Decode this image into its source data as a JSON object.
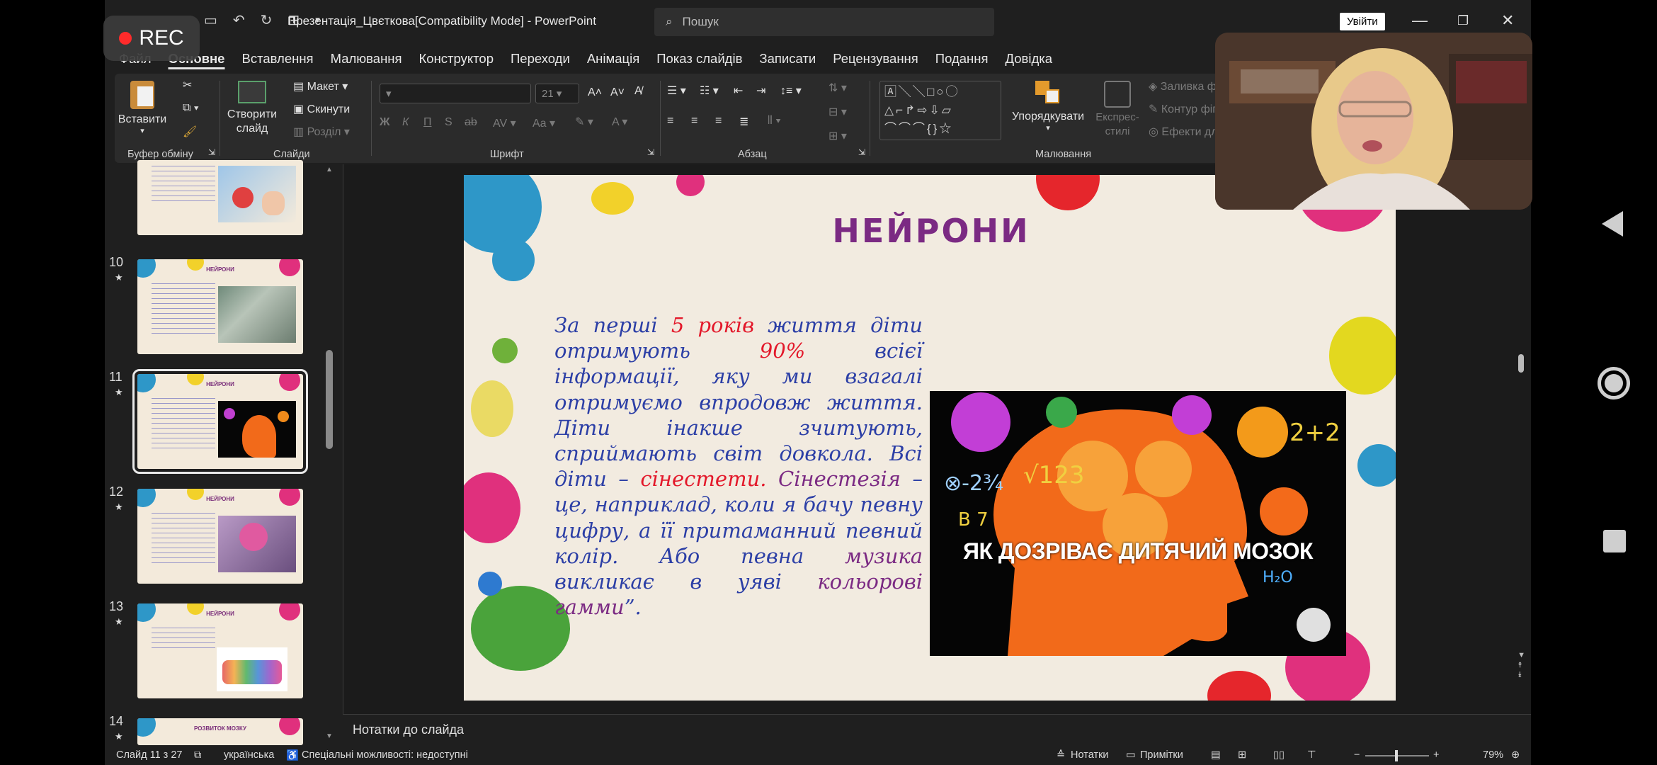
{
  "window": {
    "doc_title": "Презентація_Цвєткова[Compatibility Mode]  -  PowerPoint",
    "search_placeholder": "Пошук",
    "signin_label": "Увійти"
  },
  "recording": {
    "label": "REC"
  },
  "menu": {
    "items": [
      "Файл",
      "Основне",
      "Вставлення",
      "Малювання",
      "Конструктор",
      "Переходи",
      "Анімація",
      "Показ слайдів",
      "Записати",
      "Рецензування",
      "Подання",
      "Довідка"
    ],
    "active": "Основне"
  },
  "ribbon": {
    "clipboard": {
      "paste": "Вставити",
      "group": "Буфер обміну"
    },
    "slides": {
      "new_slide": "Створити слайд",
      "layout": "Макет",
      "reset": "Скинути",
      "section": "Розділ",
      "group": "Слайди"
    },
    "font": {
      "size": "21",
      "group": "Шрифт",
      "bold": "Ж",
      "italic": "К",
      "underline": "П",
      "shadow": "S",
      "strike": "ab",
      "case": "Aa"
    },
    "paragraph": {
      "group": "Абзац"
    },
    "drawing": {
      "arrange": "Упорядкувати",
      "quick_styles": "Експрес-стилі",
      "fill": "Заливка фігури",
      "outline": "Контур фігури",
      "effects": "Ефекти для фігури",
      "group": "Малювання"
    }
  },
  "thumbnails": [
    {
      "num": "",
      "title": ""
    },
    {
      "num": "10",
      "title": "НЕЙРОНИ"
    },
    {
      "num": "11",
      "title": "НЕЙРОНИ"
    },
    {
      "num": "12",
      "title": "НЕЙРОНИ"
    },
    {
      "num": "13",
      "title": "НЕЙРОНИ"
    },
    {
      "num": "14",
      "title": "РОЗВИТОК МОЗКУ"
    }
  ],
  "slide": {
    "title": "НЕЙРОНИ",
    "p1_a": "За перші ",
    "p1_red": "5 років",
    "p1_b": " життя діти отримують ",
    "p1_red2": "90%",
    "p1_c": " всієї інформації, яку ми взагалі отримуємо впродовж життя.",
    "p2": "Діти інакше зчитують, сприймають світ довкола. Всі діти – ",
    "p2_red": "сінестети.",
    "p3_purple": "Сінестезія",
    "p3_a": " – це, наприклад, коли я бачу певну цифру, а її притаманний певний колір. Або певна ",
    "p3_purple2": "музика",
    "p3_b": " викликає в уяві ",
    "p3_purple3": "кольорові гамми",
    "p3_end": "”.",
    "image_caption": "ЯК ДОЗРІВАЄ ДИТЯЧИЙ МОЗОК"
  },
  "notes_placeholder": "Нотатки до слайда",
  "status": {
    "slide_counter": "Слайд 11 з 27",
    "language": "українська",
    "accessibility": "Спеціальні можливості: недоступні",
    "notes": "Нотатки",
    "comments": "Примітки",
    "zoom": "79%"
  },
  "colors": {
    "title_purple": "#7b2a83",
    "text_blue": "#2c3fa6",
    "text_red": "#e3182a",
    "app_dark": "#1f1f1f"
  }
}
